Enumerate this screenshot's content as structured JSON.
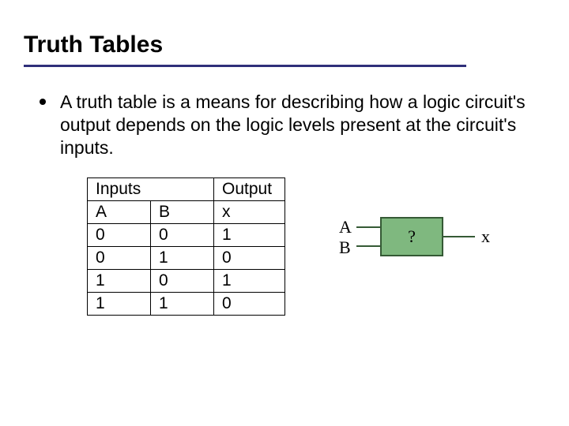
{
  "title": "Truth Tables",
  "description": "A truth table is a means for describing how a logic circuit's output depends on the logic levels present at the circuit's inputs.",
  "table": {
    "header_inputs": "Inputs",
    "header_output": "Output",
    "col_a": "A",
    "col_b": "B",
    "col_x": "x",
    "rows": [
      {
        "a": "0",
        "b": "0",
        "x": "1"
      },
      {
        "a": "0",
        "b": "1",
        "x": "0"
      },
      {
        "a": "1",
        "b": "0",
        "x": "1"
      },
      {
        "a": "1",
        "b": "1",
        "x": "0"
      }
    ]
  },
  "circuit": {
    "input_a": "A",
    "input_b": "B",
    "gate_label": "?",
    "output": "x",
    "gate_fill": "#7fb87f",
    "gate_border": "#355a35"
  }
}
